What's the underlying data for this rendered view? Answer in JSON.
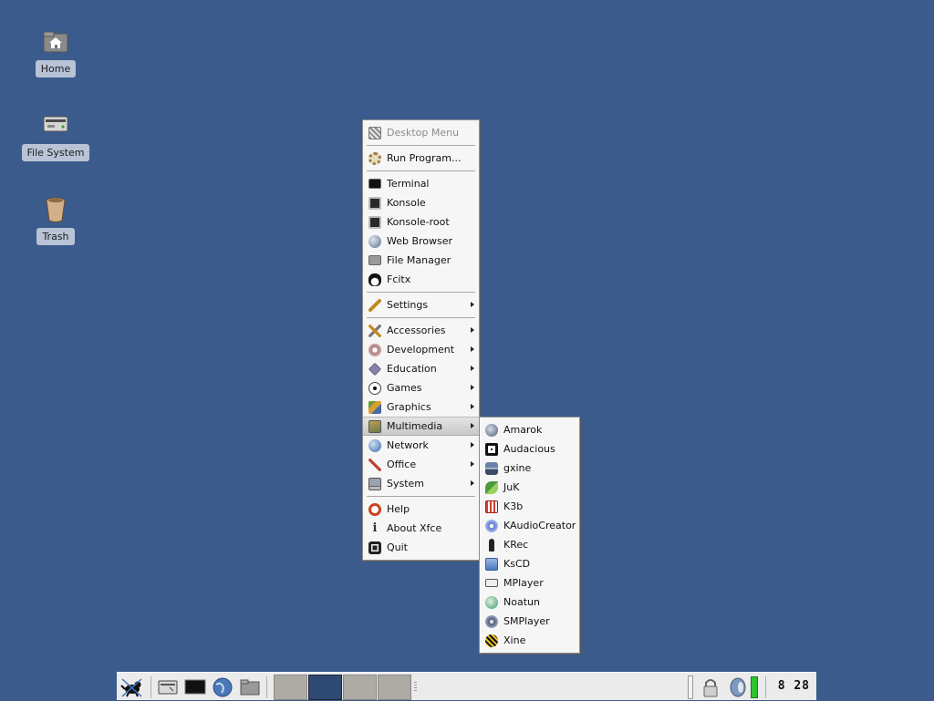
{
  "desktop": {
    "icons": [
      {
        "label": "Home",
        "icon": "home-folder-icon"
      },
      {
        "label": "File System",
        "icon": "drive-icon"
      },
      {
        "label": "Trash",
        "icon": "trash-icon"
      }
    ]
  },
  "menu": {
    "title": "Desktop Menu",
    "run_program": "Run Program...",
    "apps": [
      "Terminal",
      "Konsole",
      "Konsole-root",
      "Web Browser",
      "File Manager",
      "Fcitx"
    ],
    "settings": "Settings",
    "categories": [
      "Accessories",
      "Development",
      "Education",
      "Games",
      "Graphics",
      "Multimedia",
      "Network",
      "Office",
      "System"
    ],
    "footer": [
      "Help",
      "About Xfce",
      "Quit"
    ]
  },
  "submenu": {
    "items": [
      "Amarok",
      "Audacious",
      "gxine",
      "JuK",
      "K3b",
      "KAudioCreator",
      "KRec",
      "KsCD",
      "MPlayer",
      "Noatun",
      "SMPlayer",
      "Xine"
    ]
  },
  "panel": {
    "clock": "8 28",
    "launchers": [
      "xfce-mouse-icon",
      "drive-launcher-icon",
      "terminal-launcher-icon",
      "browser-launcher-icon",
      "folder-launcher-icon"
    ],
    "workspaces": 4,
    "active_workspace": 2
  },
  "colors": {
    "desktop": "#3b5b8c",
    "menu_bg": "#f6f6f6",
    "battery": "#2ec22e"
  }
}
